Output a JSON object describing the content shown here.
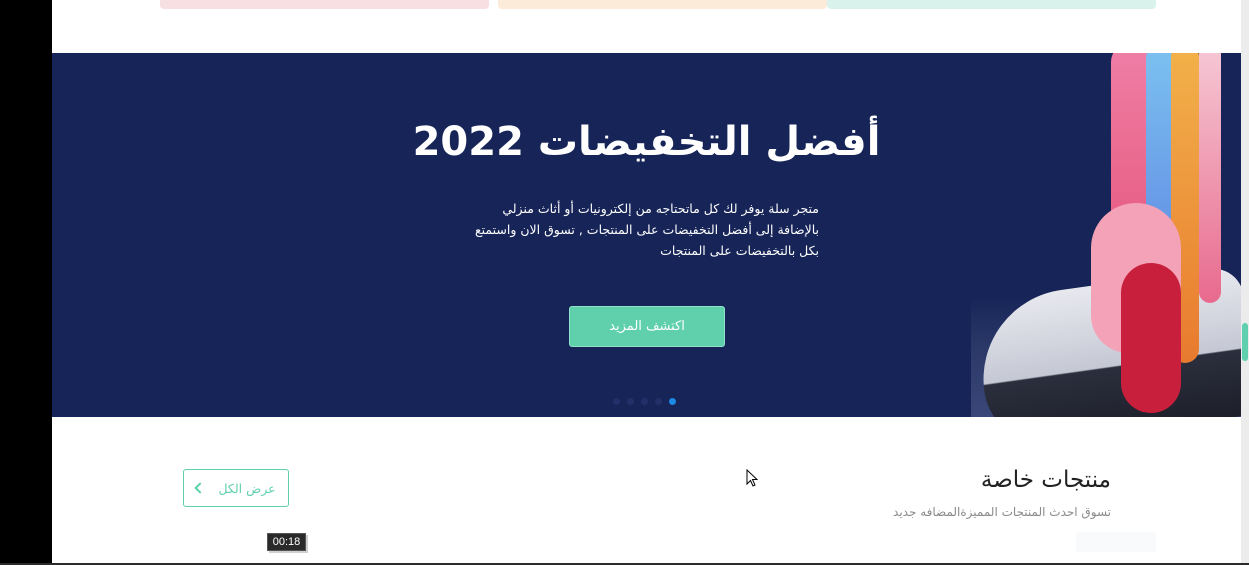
{
  "hero": {
    "title": "أفضل التخفيضات 2022",
    "description": "متجر سلة يوفر لك كل ماتحتاجه من إلكترونيات أو أثاث منزلي بالإضافة إلى أفضل التخفيضات على المنتجات , تسوق الان واستمتع بكل بالتخفيضات على المنتجات",
    "button_label": "اكتشف المزيد",
    "slides_count": 5,
    "active_slide": 5
  },
  "special_products": {
    "title": "منتجات خاصة",
    "subtitle": "تسوق احدث المنتجات المميزةالمضافه جديد",
    "view_all_label": "عرض الكل"
  },
  "video": {
    "timestamp": "00:18"
  },
  "colors": {
    "hero_bg": "#162457",
    "accent": "#5fd0ab",
    "active_dot": "#1e88e5"
  }
}
